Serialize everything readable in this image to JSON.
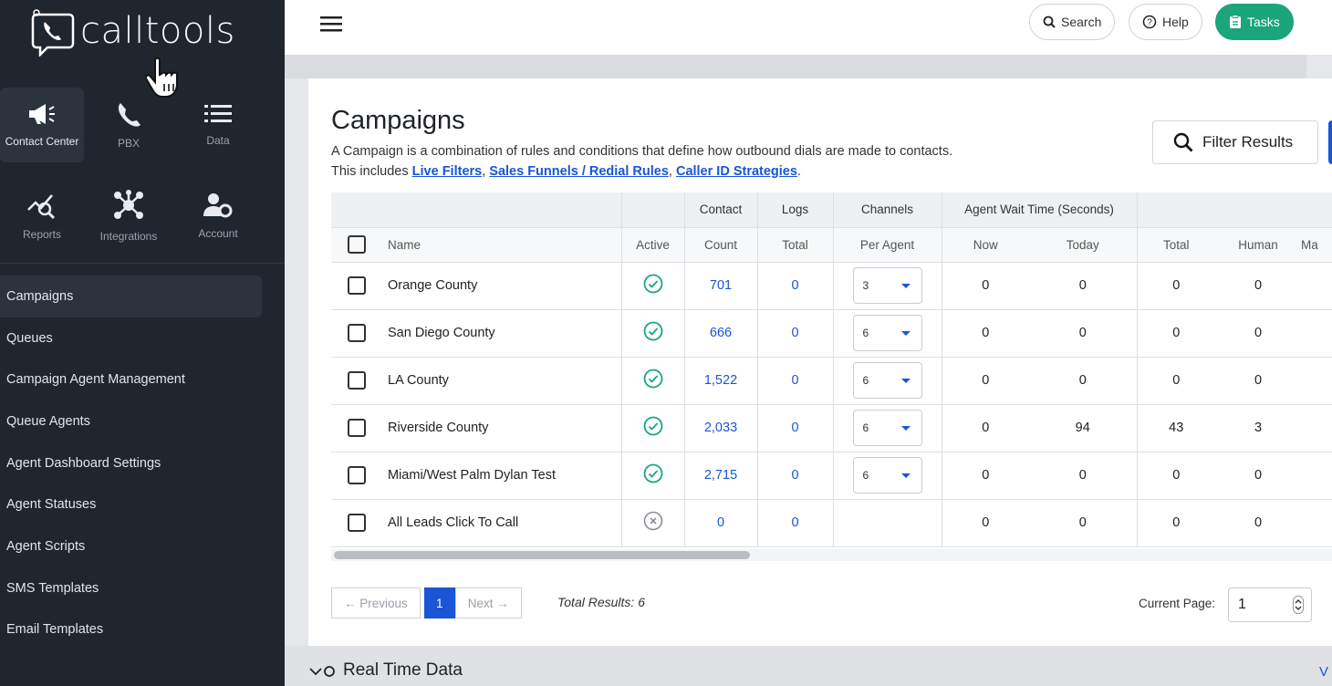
{
  "brand": {
    "name": "calltools"
  },
  "modules": [
    {
      "label": "Contact Center",
      "icon": "megaphone-icon",
      "active": true
    },
    {
      "label": "PBX",
      "icon": "phone-icon",
      "active": false
    },
    {
      "label": "Data",
      "icon": "list-icon",
      "active": false
    },
    {
      "label": "Reports",
      "icon": "reports-icon",
      "active": false
    },
    {
      "label": "Integrations",
      "icon": "integrations-icon",
      "active": false
    },
    {
      "label": "Account",
      "icon": "account-icon",
      "active": false
    }
  ],
  "nav": [
    {
      "label": "Campaigns",
      "active": true
    },
    {
      "label": "Queues"
    },
    {
      "label": "Campaign Agent Management"
    },
    {
      "label": "Queue Agents"
    },
    {
      "label": "Agent Dashboard Settings"
    },
    {
      "label": "Agent Statuses"
    },
    {
      "label": "Agent Scripts"
    },
    {
      "label": "SMS Templates"
    },
    {
      "label": "Email Templates"
    }
  ],
  "topbar": {
    "search": "Search",
    "help": "Help",
    "tasks": "Tasks"
  },
  "page": {
    "title": "Campaigns",
    "desc_line1": "A Campaign is a combination of rules and conditions that define how outbound dials are made to contacts.",
    "desc_prefix": "This includes ",
    "links": [
      "Live Filters",
      "Sales Funnels / Redial Rules",
      "Caller ID Strategies"
    ],
    "sep": ", ",
    "end": ".",
    "filter_button": "Filter Results"
  },
  "table": {
    "group_headers": {
      "contact": "Contact",
      "logs": "Logs",
      "channels": "Channels",
      "wait": "Agent Wait Time (Seconds)"
    },
    "columns": {
      "name": "Name",
      "active": "Active",
      "count": "Count",
      "total": "Total",
      "per_agent": "Per Agent",
      "now": "Now",
      "today": "Today",
      "total2": "Total",
      "human": "Human",
      "ma": "Ma"
    },
    "rows": [
      {
        "name": "Orange County",
        "active": true,
        "count": "701",
        "logs": "0",
        "channels": "3",
        "now": "0",
        "today": "0",
        "total": "0",
        "human": "0"
      },
      {
        "name": "San Diego County",
        "active": true,
        "count": "666",
        "logs": "0",
        "channels": "6",
        "now": "0",
        "today": "0",
        "total": "0",
        "human": "0"
      },
      {
        "name": "LA County",
        "active": true,
        "count": "1,522",
        "logs": "0",
        "channels": "6",
        "now": "0",
        "today": "0",
        "total": "0",
        "human": "0"
      },
      {
        "name": "Riverside County",
        "active": true,
        "count": "2,033",
        "logs": "0",
        "channels": "6",
        "now": "0",
        "today": "94",
        "total": "43",
        "human": "3"
      },
      {
        "name": "Miami/West Palm Dylan Test",
        "active": true,
        "count": "2,715",
        "logs": "0",
        "channels": "6",
        "now": "0",
        "today": "0",
        "total": "0",
        "human": "0"
      },
      {
        "name": "All Leads Click To Call",
        "active": false,
        "count": "0",
        "logs": "0",
        "channels": "",
        "now": "0",
        "today": "0",
        "total": "0",
        "human": "0"
      }
    ]
  },
  "pagination": {
    "prev": "← Previous",
    "current": "1",
    "next": "Next →",
    "total": "Total Results: 6",
    "current_label": "Current Page:",
    "current_value": "1"
  },
  "realtime": {
    "title": "Real Time Data",
    "edge": "V"
  },
  "colors": {
    "sidebar": "#1f262e",
    "accent": "#1a55d6",
    "tasks": "#1aa57a",
    "active_check": "#1aa57a"
  }
}
